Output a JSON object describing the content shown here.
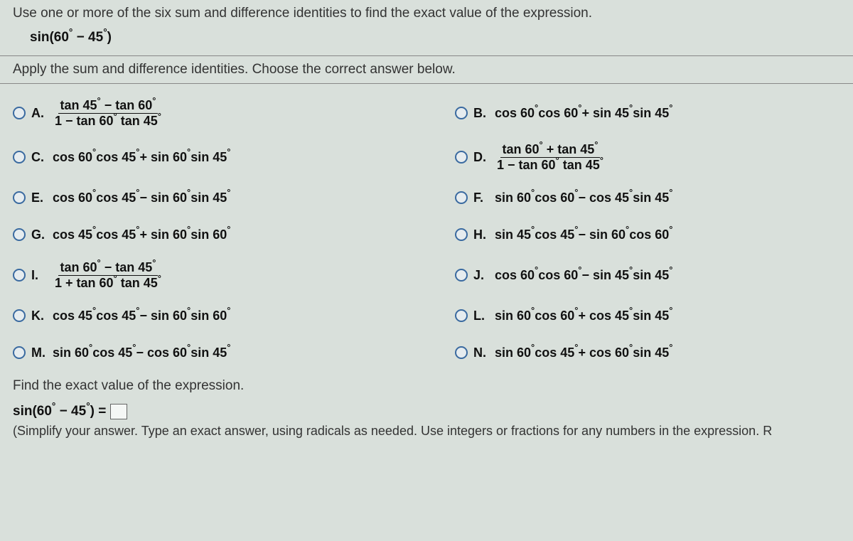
{
  "question": {
    "prompt": "Use one or more of the six sum and difference identities to find the exact value of the expression.",
    "expression_prefix": "sin(60",
    "expression_mid": " − 45",
    "expression_suffix": ")"
  },
  "instruction": "Apply the sum and difference identities. Choose the correct answer below.",
  "choices": {
    "A": {
      "label": "A.",
      "type": "frac",
      "num_parts": [
        "tan 45",
        " − tan 60",
        ""
      ],
      "den_parts": [
        "1 − tan 60",
        " tan 45",
        ""
      ]
    },
    "B": {
      "label": "B.",
      "type": "plain",
      "parts": [
        "cos 60",
        " cos 60",
        " + sin 45",
        " sin 45",
        ""
      ]
    },
    "C": {
      "label": "C.",
      "type": "plain",
      "parts": [
        "cos 60",
        " cos 45",
        " + sin 60",
        " sin 45",
        ""
      ]
    },
    "D": {
      "label": "D.",
      "type": "frac",
      "num_parts": [
        "tan 60",
        " + tan 45",
        ""
      ],
      "den_parts": [
        "1 − tan 60",
        " tan 45",
        ""
      ]
    },
    "E": {
      "label": "E.",
      "type": "plain",
      "parts": [
        "cos 60",
        " cos 45",
        " − sin 60",
        " sin 45",
        ""
      ]
    },
    "F": {
      "label": "F.",
      "type": "plain",
      "parts": [
        "sin 60",
        " cos 60",
        " − cos 45",
        " sin 45",
        ""
      ]
    },
    "G": {
      "label": "G.",
      "type": "plain",
      "parts": [
        "cos 45",
        " cos 45",
        " + sin 60",
        " sin 60",
        ""
      ]
    },
    "H": {
      "label": "H.",
      "type": "plain",
      "parts": [
        "sin 45",
        " cos 45",
        " − sin 60",
        " cos 60",
        ""
      ]
    },
    "I": {
      "label": "I.",
      "type": "frac",
      "num_parts": [
        "tan 60",
        " − tan 45",
        ""
      ],
      "den_parts": [
        "1 + tan 60",
        " tan 45",
        ""
      ]
    },
    "J": {
      "label": "J.",
      "type": "plain",
      "parts": [
        "cos 60",
        " cos 60",
        " − sin 45",
        " sin 45",
        ""
      ]
    },
    "K": {
      "label": "K.",
      "type": "plain",
      "parts": [
        "cos 45",
        " cos 45",
        " − sin 60",
        " sin 60",
        ""
      ]
    },
    "L": {
      "label": "L.",
      "type": "plain",
      "parts": [
        "sin 60",
        " cos 60",
        " + cos 45",
        " sin 45",
        ""
      ]
    },
    "M": {
      "label": "M.",
      "type": "plain",
      "parts": [
        "sin 60",
        " cos 45",
        " − cos 60",
        " sin 45",
        ""
      ]
    },
    "N": {
      "label": "N.",
      "type": "plain",
      "parts": [
        "sin 60",
        " cos 45",
        " + cos 60",
        " sin 45",
        ""
      ]
    }
  },
  "deg": "°",
  "bottom": {
    "find": "Find the exact value of the expression.",
    "ans_prefix": "sin(60",
    "ans_mid": " − 45",
    "ans_suffix": ") =",
    "hint": "(Simplify your answer. Type an exact answer, using radicals as needed. Use integers or fractions for any numbers in the expression. R"
  }
}
